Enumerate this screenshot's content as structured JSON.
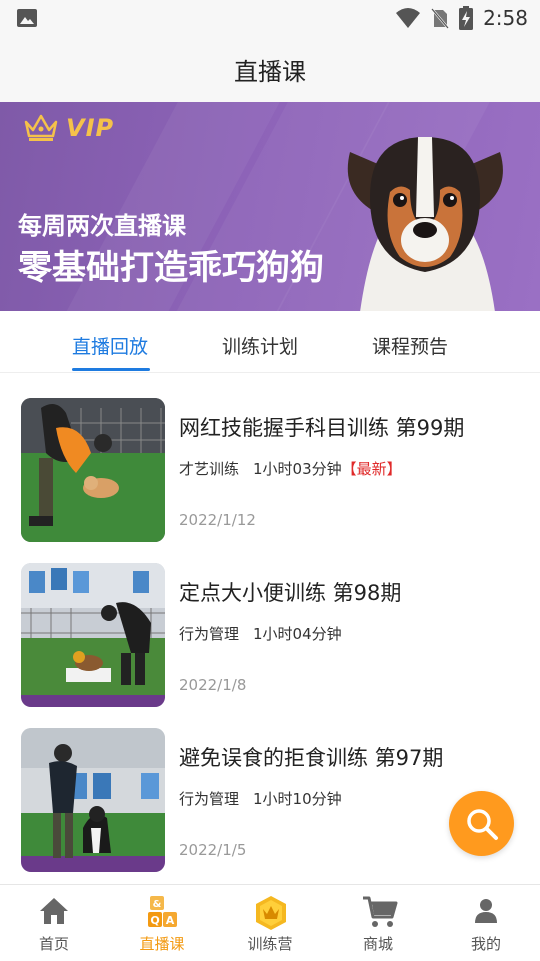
{
  "status_bar": {
    "time": "2:58"
  },
  "header": {
    "title": "直播课"
  },
  "banner": {
    "vip_label": "VIP",
    "line1": "每周两次直播课",
    "line2": "零基础打造乖巧狗狗"
  },
  "tabs": [
    {
      "label": "直播回放",
      "active": true
    },
    {
      "label": "训练计划",
      "active": false
    },
    {
      "label": "课程预告",
      "active": false
    }
  ],
  "courses": [
    {
      "title": "网红技能握手科目训练 第99期",
      "category": "才艺训练",
      "duration": "1小时03分钟",
      "tag": "【最新】",
      "date": "2022/1/12"
    },
    {
      "title": "定点大小便训练 第98期",
      "category": "行为管理",
      "duration": "1小时04分钟",
      "tag": "",
      "date": "2022/1/8"
    },
    {
      "title": "避免误食的拒食训练 第97期",
      "category": "行为管理",
      "duration": "1小时10分钟",
      "tag": "",
      "date": "2022/1/5"
    }
  ],
  "bottom_nav": [
    {
      "label": "首页",
      "icon": "home-icon",
      "active": false
    },
    {
      "label": "直播课",
      "icon": "qa-blocks-icon",
      "active": true
    },
    {
      "label": "训练营",
      "icon": "crown-badge-icon",
      "active": false
    },
    {
      "label": "商城",
      "icon": "cart-icon",
      "active": false
    },
    {
      "label": "我的",
      "icon": "person-icon",
      "active": false
    }
  ],
  "colors": {
    "accent": "#1e7be0",
    "nav_active": "#f39a12",
    "fab": "#ff9a1e",
    "banner": "#8d63b8",
    "new_tag": "#e02a2a"
  }
}
